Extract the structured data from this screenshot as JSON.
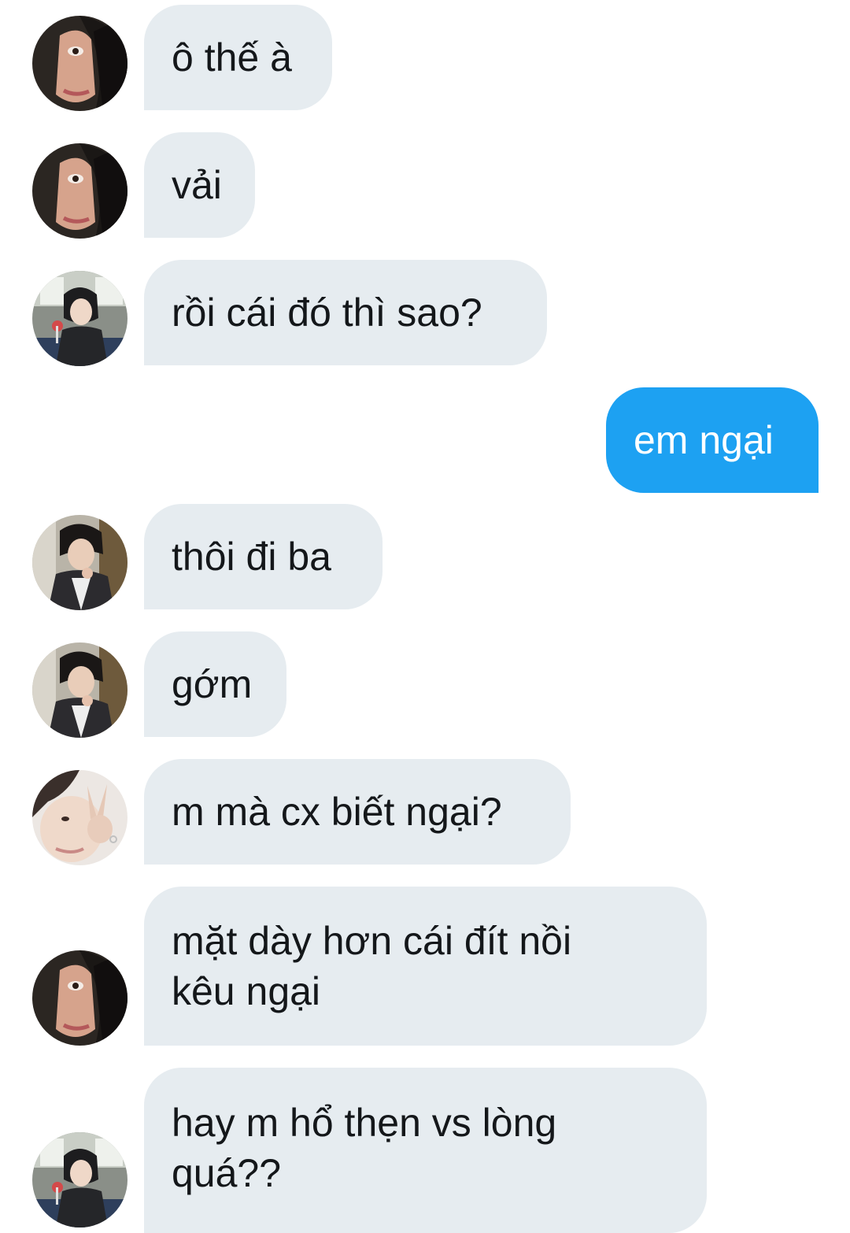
{
  "conversation": {
    "messages": [
      {
        "side": "in",
        "avatar": "avatar-hooded",
        "lines": [
          "ô thế à"
        ]
      },
      {
        "side": "in",
        "avatar": "avatar-hooded",
        "lines": [
          "vải"
        ]
      },
      {
        "side": "in",
        "avatar": "avatar-bus",
        "lines": [
          "rồi cái đó thì sao?"
        ]
      },
      {
        "side": "out",
        "lines": [
          "em ngại"
        ]
      },
      {
        "side": "in",
        "avatar": "avatar-jacket",
        "lines": [
          "thôi đi ba"
        ]
      },
      {
        "side": "in",
        "avatar": "avatar-jacket",
        "lines": [
          "gớm"
        ]
      },
      {
        "side": "in",
        "avatar": "avatar-peace",
        "lines": [
          "m mà cx biết ngại?"
        ]
      },
      {
        "side": "in",
        "avatar": "avatar-hooded",
        "lines": [
          "mặt dày hơn cái đít nồi",
          "kêu ngại"
        ]
      },
      {
        "side": "in",
        "avatar": "avatar-bus",
        "lines": [
          "hay m hổ thẹn vs lòng",
          "quá??"
        ]
      }
    ]
  },
  "colors": {
    "incoming_bubble": "#e6ecf0",
    "outgoing_bubble": "#1da1f2",
    "incoming_text": "#14171a",
    "outgoing_text": "#ffffff"
  }
}
